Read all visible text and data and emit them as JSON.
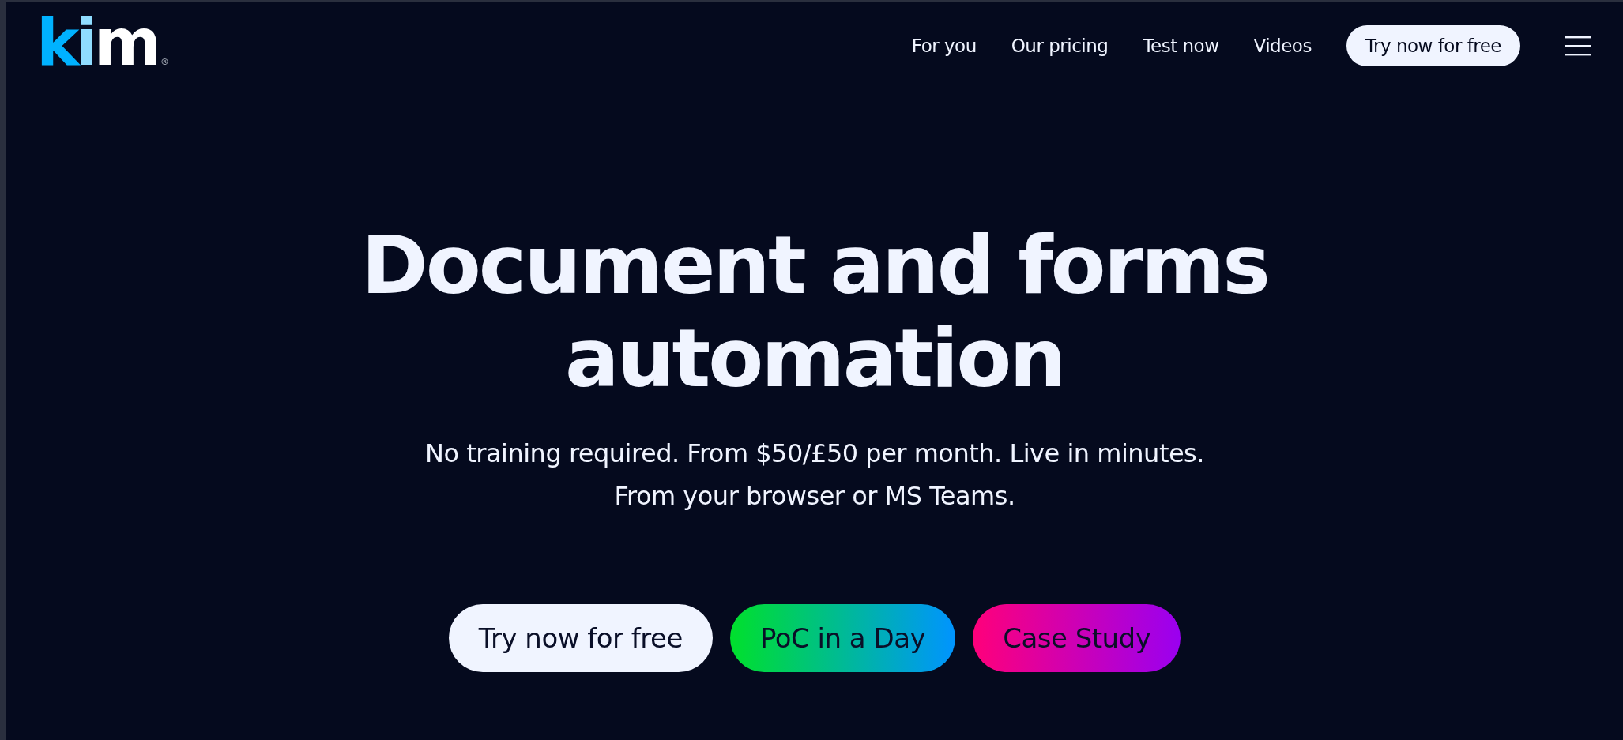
{
  "logo": {
    "text": "kim",
    "mark": "®"
  },
  "nav": {
    "links": [
      "For you",
      "Our pricing",
      "Test now",
      "Videos"
    ],
    "cta": "Try now for free"
  },
  "hero": {
    "title": [
      "Document and forms",
      "automation"
    ],
    "subtitle": [
      "No training required. From $50/£50 per month. Live in minutes.",
      "From your browser or MS Teams."
    ],
    "buttons": [
      {
        "label": "Try now for free",
        "kind": "light"
      },
      {
        "label": "PoC in a Day",
        "kind": "green"
      },
      {
        "label": "Case Study",
        "kind": "pink"
      }
    ]
  }
}
